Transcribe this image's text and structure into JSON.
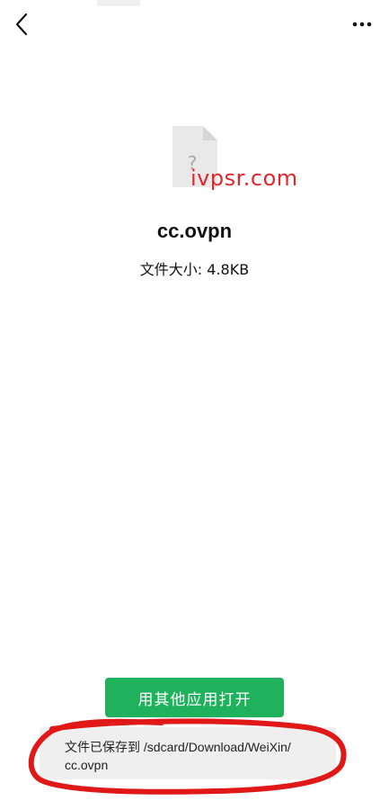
{
  "header": {
    "back_icon": "chevron-left-icon",
    "more_icon": "more-horizontal-icon"
  },
  "file": {
    "icon": "unknown-file-icon",
    "icon_glyph": "?",
    "name": "cc.ovpn",
    "size_label": "文件大小: 4.8KB"
  },
  "watermark": {
    "text": "ivpsr.com",
    "color": "#e2262b"
  },
  "actions": {
    "open_with_label": "用其他应用打开",
    "accent_color": "#20b15c"
  },
  "saved_notice": {
    "line1": "文件已保存到 /sdcard/Download/WeiXin/",
    "line2": "cc.ovpn"
  },
  "annotation": {
    "shape": "red-freehand-ellipse",
    "color": "#e01818"
  }
}
